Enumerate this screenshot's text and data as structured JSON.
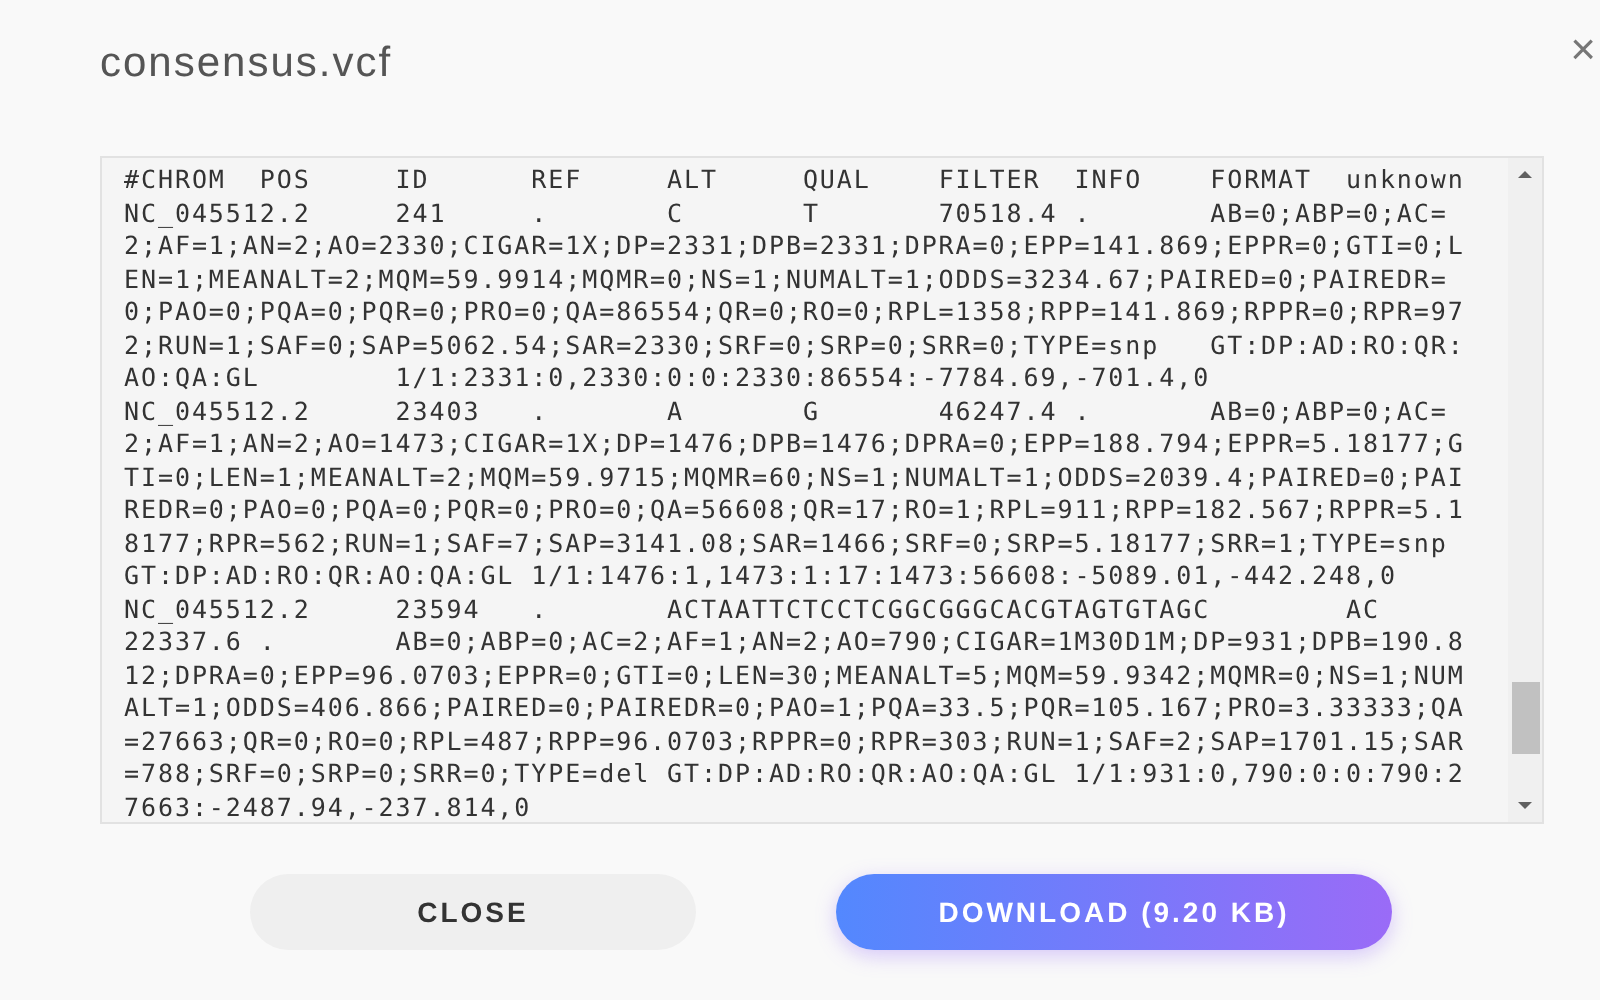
{
  "dialog": {
    "title": "consensus.vcf",
    "close_glyph": "×"
  },
  "file_content": {
    "lines": [
      "#CHROM\tPOS\tID\tREF\tALT\tQUAL\tFILTER\tINFO\tFORMAT\tunknown",
      "NC_045512.2\t241\t.\tC\tT\t70518.4\t.\tAB=0;ABP=0;AC=",
      "2;AF=1;AN=2;AO=2330;CIGAR=1X;DP=2331;DPB=2331;DPRA=0;EPP=141.869;EPPR=0;GTI=0;L",
      "EN=1;MEANALT=2;MQM=59.9914;MQMR=0;NS=1;NUMALT=1;ODDS=3234.67;PAIRED=0;PAIREDR=",
      "0;PAO=0;PQA=0;PQR=0;PRO=0;QA=86554;QR=0;RO=0;RPL=1358;RPP=141.869;RPPR=0;RPR=97",
      "2;RUN=1;SAF=0;SAP=5062.54;SAR=2330;SRF=0;SRP=0;SRR=0;TYPE=snp\tGT:DP:AD:RO:QR:",
      "AO:QA:GL\t1/1:2331:0,2330:0:0:2330:86554:-7784.69,-701.4,0",
      "NC_045512.2\t23403\t.\tA\tG\t46247.4\t.\tAB=0;ABP=0;AC=",
      "2;AF=1;AN=2;AO=1473;CIGAR=1X;DP=1476;DPB=1476;DPRA=0;EPP=188.794;EPPR=5.18177;G",
      "TI=0;LEN=1;MEANALT=2;MQM=59.9715;MQMR=60;NS=1;NUMALT=1;ODDS=2039.4;PAIRED=0;PAI",
      "REDR=0;PAO=0;PQA=0;PQR=0;PRO=0;QA=56608;QR=17;RO=1;RPL=911;RPP=182.567;RPPR=5.1",
      "8177;RPR=562;RUN=1;SAF=7;SAP=3141.08;SAR=1466;SRF=0;SRP=5.18177;SRR=1;TYPE=snp",
      "GT:DP:AD:RO:QR:AO:QA:GL\t1/1:1476:1,1473:1:17:1473:56608:-5089.01,-442.248,0",
      "NC_045512.2\t23594\t.\tACTAATTCTCCTCGGCGGGCACGTAGTGTAGC\tAC",
      "22337.6\t.\tAB=0;ABP=0;AC=2;AF=1;AN=2;AO=790;CIGAR=1M30D1M;DP=931;DPB=190.8",
      "12;DPRA=0;EPP=96.0703;EPPR=0;GTI=0;LEN=30;MEANALT=5;MQM=59.9342;MQMR=0;NS=1;NUM",
      "ALT=1;ODDS=406.866;PAIRED=0;PAIREDR=0;PAO=1;PQA=33.5;PQR=105.167;PRO=3.33333;QA",
      "=27663;QR=0;RO=0;RPL=487;RPP=96.0703;RPPR=0;RPR=303;RUN=1;SAF=2;SAP=1701.15;SAR",
      "=788;SRF=0;SRP=0;SRR=0;TYPE=del\tGT:DP:AD:RO:QR:AO:QA:GL 1/1:931:0,790:0:0:790:2",
      "7663:-2487.94,-237.814,0"
    ]
  },
  "buttons": [
    {
      "label": "CLOSE",
      "kind": "secondary"
    },
    {
      "label": "DOWNLOAD (9.20 KB)",
      "kind": "primary"
    }
  ]
}
